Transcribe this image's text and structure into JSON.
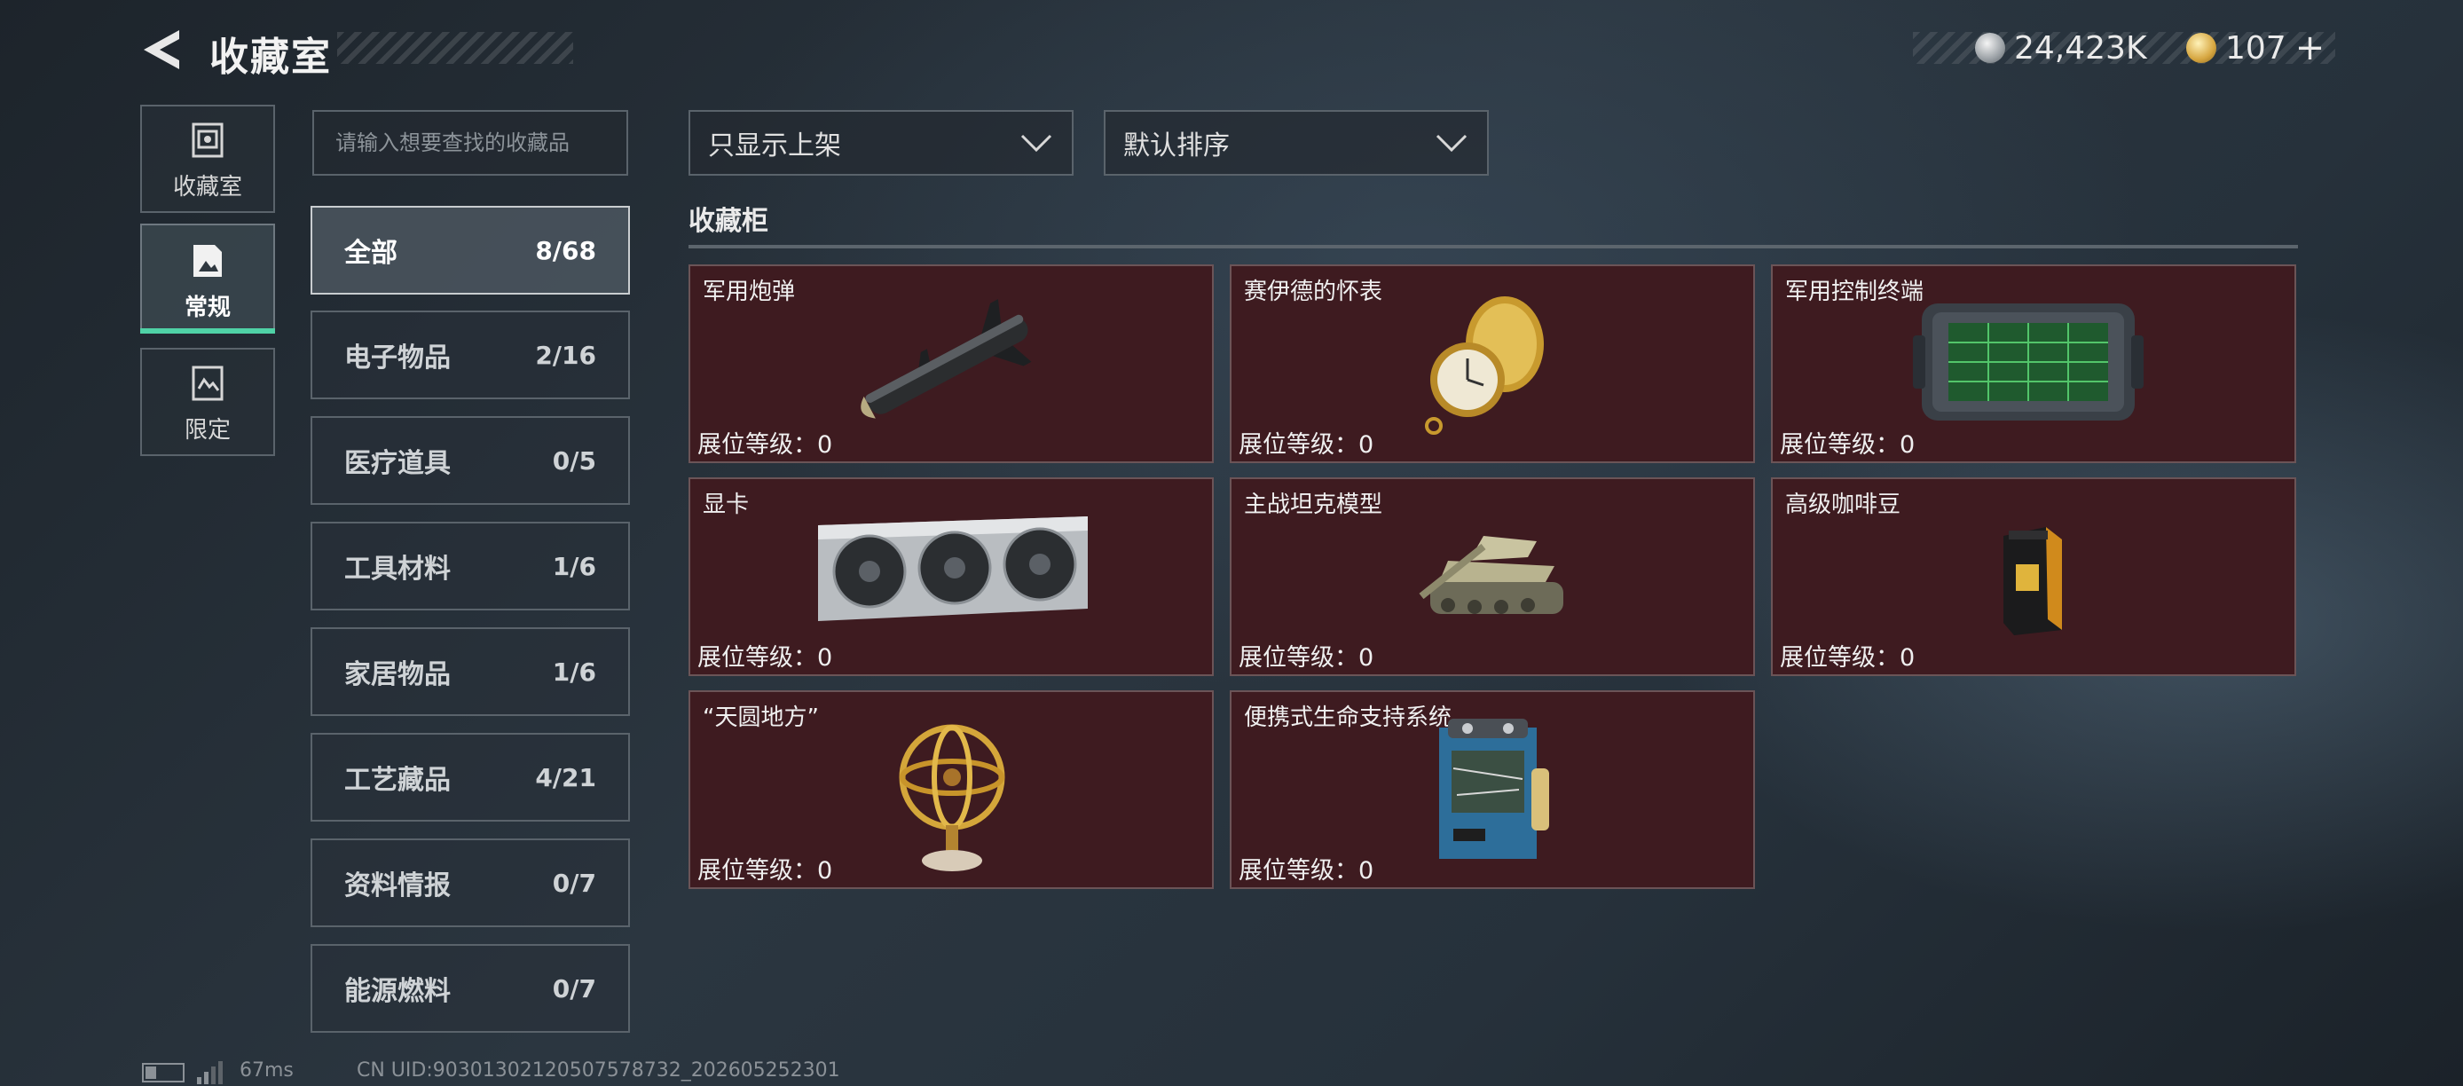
{
  "header": {
    "title": "收藏室",
    "currency_1": "24,423K",
    "currency_2": "107",
    "plus": "+"
  },
  "nav": [
    {
      "label": "收藏室",
      "icon": "collection-room-icon"
    },
    {
      "label": "常规",
      "icon": "regular-icon"
    },
    {
      "label": "限定",
      "icon": "limited-icon"
    }
  ],
  "search": {
    "placeholder": "请输入想要查找的收藏品"
  },
  "categories": [
    {
      "label": "全部",
      "count": "8/68"
    },
    {
      "label": "电子物品",
      "count": "2/16"
    },
    {
      "label": "医疗道具",
      "count": "0/5"
    },
    {
      "label": "工具材料",
      "count": "1/6"
    },
    {
      "label": "家居物品",
      "count": "1/6"
    },
    {
      "label": "工艺藏品",
      "count": "4/21"
    },
    {
      "label": "资料情报",
      "count": "0/7"
    },
    {
      "label": "能源燃料",
      "count": "0/7"
    }
  ],
  "filters": {
    "filter_label": "只显示上架",
    "sort_label": "默认排序"
  },
  "section": {
    "title": "收藏柜"
  },
  "cards": [
    {
      "name": "军用炮弹",
      "level_label": "展位等级：",
      "level": "0",
      "icon": "missile-icon"
    },
    {
      "name": "赛伊德的怀表",
      "level_label": "展位等级：",
      "level": "0",
      "icon": "pocket-watch-icon"
    },
    {
      "name": "军用控制终端",
      "level_label": "展位等级：",
      "level": "0",
      "icon": "control-terminal-icon"
    },
    {
      "name": "显卡",
      "level_label": "展位等级：",
      "level": "0",
      "icon": "graphics-card-icon"
    },
    {
      "name": "主战坦克模型",
      "level_label": "展位等级：",
      "level": "0",
      "icon": "tank-model-icon"
    },
    {
      "name": "高级咖啡豆",
      "level_label": "展位等级：",
      "level": "0",
      "icon": "coffee-bag-icon"
    },
    {
      "name": "“天圆地方”",
      "level_label": "展位等级：",
      "level": "0",
      "icon": "armillary-sphere-icon"
    },
    {
      "name": "便携式生命支持系统",
      "level_label": "展位等级：",
      "level": "0",
      "icon": "life-support-icon"
    }
  ],
  "footer": {
    "ping": "67ms",
    "uid": "CN UID:90301302120507578732_202605252301"
  }
}
